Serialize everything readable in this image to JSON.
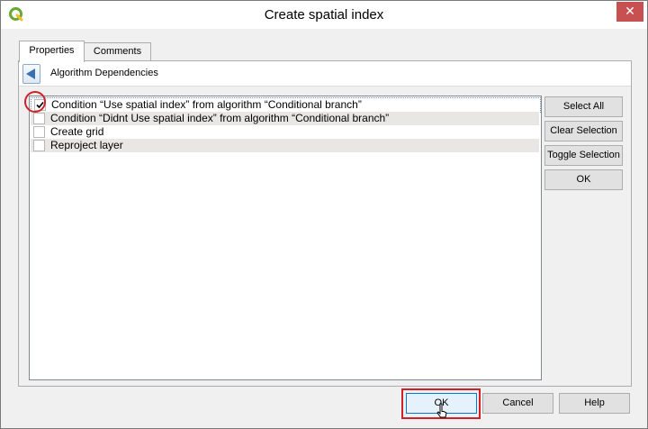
{
  "window": {
    "title": "Create spatial index",
    "close_label": "✕",
    "app_icon": "qgis-icon"
  },
  "tabs": [
    {
      "label": "Properties",
      "active": true
    },
    {
      "label": "Comments",
      "active": false
    }
  ],
  "header": {
    "back_icon": "back-arrow-icon",
    "label": "Algorithm Dependencies"
  },
  "list": {
    "items": [
      {
        "label": "Condition “Use spatial index” from algorithm “Conditional branch”",
        "checked": true
      },
      {
        "label": "Condition “Didnt Use spatial index” from algorithm “Conditional branch”",
        "checked": false
      },
      {
        "label": "Create grid",
        "checked": false
      },
      {
        "label": "Reproject layer",
        "checked": false
      }
    ]
  },
  "side_buttons": {
    "select_all": "Select All",
    "clear_selection": "Clear Selection",
    "toggle_selection": "Toggle Selection",
    "ok": "OK"
  },
  "footer": {
    "ok": "OK",
    "cancel": "Cancel",
    "help": "Help"
  },
  "colors": {
    "annotation": "#d0202a",
    "close_button": "#c75050",
    "focus_border": "#0078d7"
  }
}
